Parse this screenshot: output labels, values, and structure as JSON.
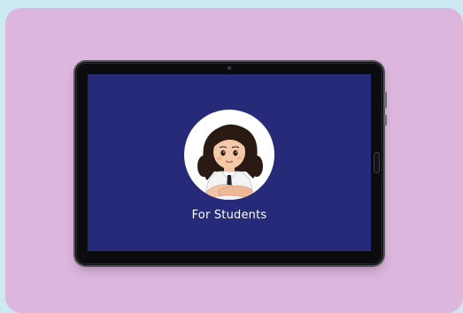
{
  "screen": {
    "caption": "For Students"
  },
  "icons": {
    "avatar": "student-girl-avatar-icon",
    "camera": "camera-icon"
  },
  "colors": {
    "background": "#cdeaf3",
    "card": "#dcb6dc",
    "screen": "#272a78",
    "caption_text": "#ffffff"
  }
}
